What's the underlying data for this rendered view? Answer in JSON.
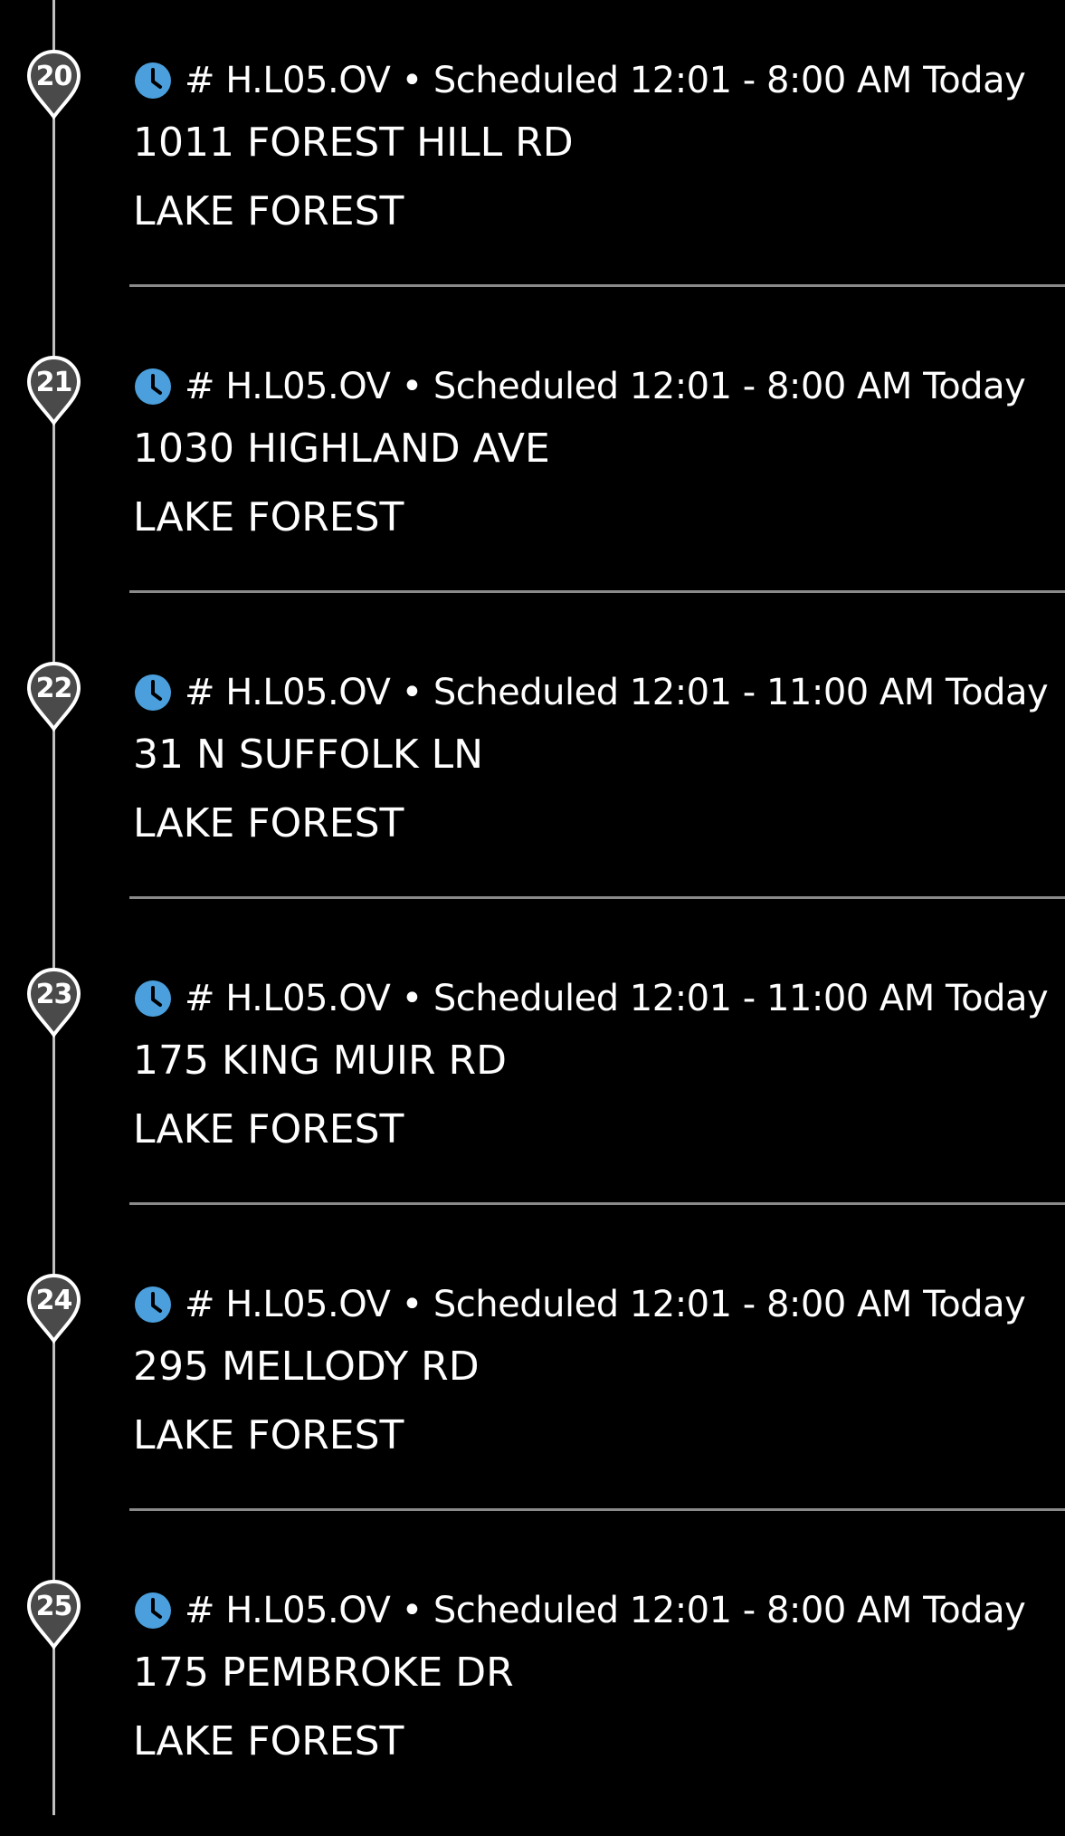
{
  "stops": [
    {
      "number": "20",
      "meta": "# H.L05.OV • Scheduled 12:01 - 8:00 AM Today",
      "address": "1011 FOREST HILL RD",
      "city": "LAKE FOREST"
    },
    {
      "number": "21",
      "meta": "# H.L05.OV • Scheduled 12:01 - 8:00 AM Today",
      "address": "1030 HIGHLAND AVE",
      "city": "LAKE FOREST"
    },
    {
      "number": "22",
      "meta": "# H.L05.OV • Scheduled 12:01 - 11:00 AM Today",
      "address": "31 N SUFFOLK LN",
      "city": "LAKE FOREST"
    },
    {
      "number": "23",
      "meta": "# H.L05.OV • Scheduled 12:01 - 11:00 AM Today",
      "address": "175 KING MUIR RD",
      "city": "LAKE FOREST"
    },
    {
      "number": "24",
      "meta": "# H.L05.OV • Scheduled 12:01 - 8:00 AM Today",
      "address": "295 MELLODY RD",
      "city": "LAKE FOREST"
    },
    {
      "number": "25",
      "meta": "# H.L05.OV • Scheduled 12:01 - 8:00 AM Today",
      "address": "175 PEMBROKE DR",
      "city": "LAKE FOREST"
    }
  ],
  "icons": {
    "pin": "map-pin-icon",
    "clock": "clock-icon"
  },
  "colors": {
    "background": "#000000",
    "text": "#ffffff",
    "clock_accent": "#4a9fdc",
    "timeline": "#bfbfbf",
    "divider": "#8a8a8a"
  }
}
